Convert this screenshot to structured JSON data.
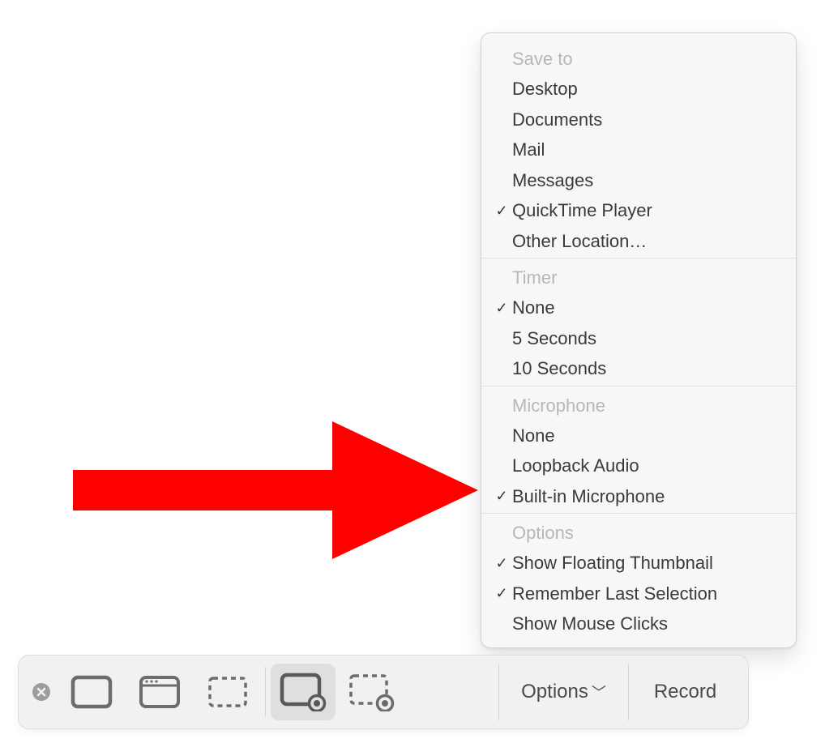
{
  "menu": {
    "sections": [
      {
        "header": "Save to",
        "items": [
          {
            "label": "Desktop",
            "checked": false
          },
          {
            "label": "Documents",
            "checked": false
          },
          {
            "label": "Mail",
            "checked": false
          },
          {
            "label": "Messages",
            "checked": false
          },
          {
            "label": "QuickTime Player",
            "checked": true
          },
          {
            "label": "Other Location…",
            "checked": false
          }
        ]
      },
      {
        "header": "Timer",
        "items": [
          {
            "label": "None",
            "checked": true
          },
          {
            "label": "5 Seconds",
            "checked": false
          },
          {
            "label": "10 Seconds",
            "checked": false
          }
        ]
      },
      {
        "header": "Microphone",
        "items": [
          {
            "label": "None",
            "checked": false
          },
          {
            "label": "Loopback Audio",
            "checked": false
          },
          {
            "label": "Built-in Microphone",
            "checked": true
          }
        ]
      },
      {
        "header": "Options",
        "items": [
          {
            "label": "Show Floating Thumbnail",
            "checked": true
          },
          {
            "label": "Remember Last Selection",
            "checked": true
          },
          {
            "label": "Show Mouse Clicks",
            "checked": false
          }
        ]
      }
    ]
  },
  "toolbar": {
    "options_label": "Options",
    "record_label": "Record",
    "active_tool": "record_full"
  },
  "arrow": {
    "color": "#ff0000"
  }
}
